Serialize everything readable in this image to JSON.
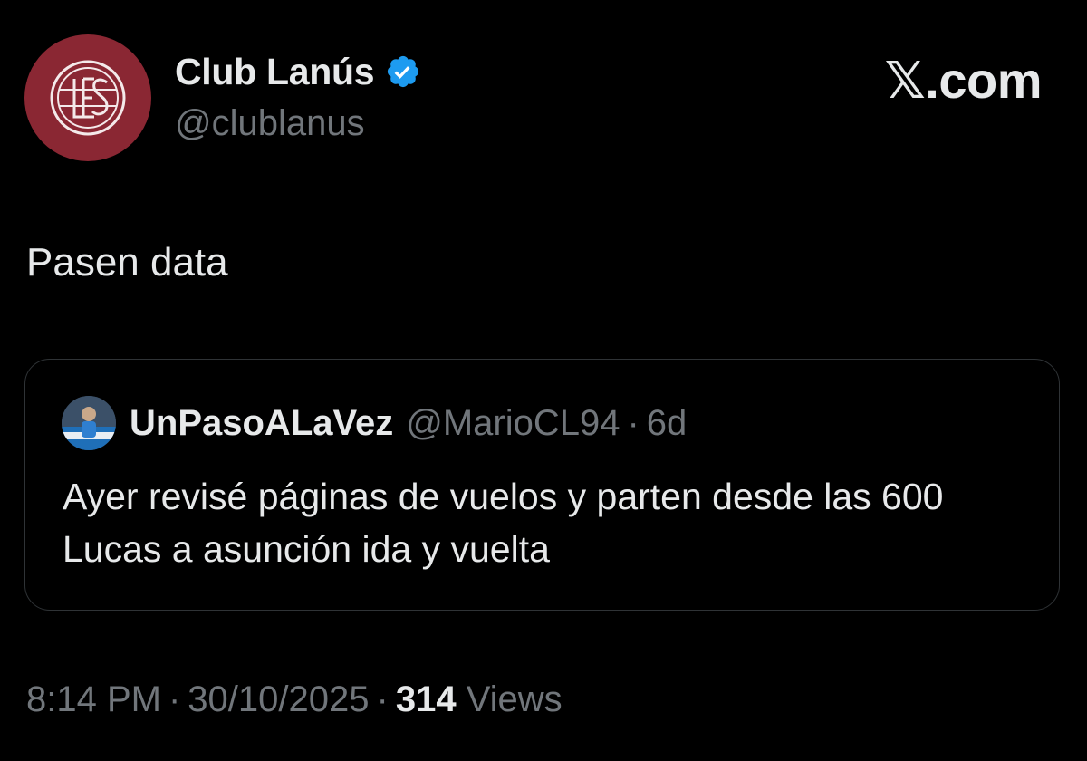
{
  "author": {
    "display_name": "Club Lanús",
    "handle": "@clublanus",
    "verified": true,
    "avatar_icon": "club-crest-icon",
    "avatar_color": "#8a2733"
  },
  "brand": {
    "label": "𝕏.com"
  },
  "tweet": {
    "text": "Pasen data"
  },
  "quoted_tweet": {
    "display_name": "UnPasoALaVez",
    "handle": "@MarioCL94",
    "separator": "·",
    "time_ago": "6d",
    "avatar_icon": "user-avatar-icon",
    "text": "Ayer revisé páginas de vuelos y parten desde las 600 Lucas a asunción ida y vuelta"
  },
  "meta": {
    "time": "8:14 PM",
    "separator": "·",
    "date": "30/10/2025",
    "views_count": "314",
    "views_label": "Views"
  },
  "colors": {
    "background": "#000000",
    "primary_text": "#e7e9ea",
    "secondary_text": "#71767b",
    "border": "#2f3336",
    "verified_blue": "#1d9bf0"
  }
}
